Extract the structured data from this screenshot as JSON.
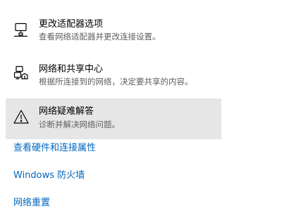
{
  "items": [
    {
      "icon": "network-adapter-icon",
      "title": "更改适配器选项",
      "desc": "查看网络适配器并更改连接设置。"
    },
    {
      "icon": "sharing-center-icon",
      "title": "网络和共享中心",
      "desc": "根据所连接到的网络，决定要共享的内容。"
    },
    {
      "icon": "warning-triangle-icon",
      "title": "网络疑难解答",
      "desc": "诊断并解决网络问题。"
    }
  ],
  "links": [
    {
      "label": "查看硬件和连接属性"
    },
    {
      "label": "Windows 防火墙"
    },
    {
      "label": "网络重置"
    }
  ],
  "colors": {
    "link": "#0067c0",
    "hover_bg": "#e6e6e6",
    "desc_text": "#5f5f5f"
  }
}
